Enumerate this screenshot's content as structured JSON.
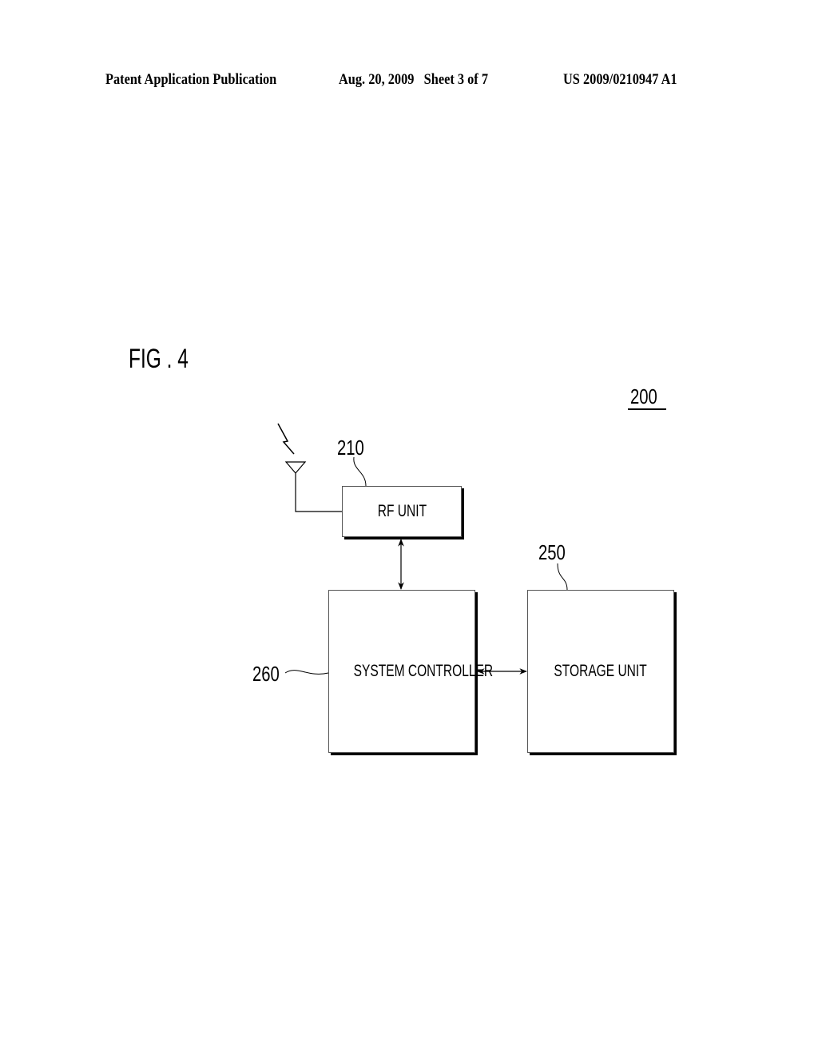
{
  "header": {
    "publication": "Patent Application Publication",
    "date_sheet": "Aug. 20, 2009   Sheet 3 of 7",
    "number": "US 2009/0210947 A1"
  },
  "figure": {
    "title": "FIG . 4",
    "ref_main": "200",
    "blocks": {
      "rf_unit": {
        "label": "RF UNIT",
        "ref": "210"
      },
      "system_controller": {
        "label": "SYSTEM CONTROLLER",
        "ref": "260"
      },
      "storage_unit": {
        "label": "STORAGE UNIT",
        "ref": "250"
      }
    },
    "connections": [
      {
        "from": "rf_unit",
        "to": "system_controller",
        "type": "bidirectional"
      },
      {
        "from": "system_controller",
        "to": "storage_unit",
        "type": "bidirectional"
      },
      {
        "from": "antenna",
        "to": "rf_unit",
        "type": "line"
      }
    ]
  }
}
